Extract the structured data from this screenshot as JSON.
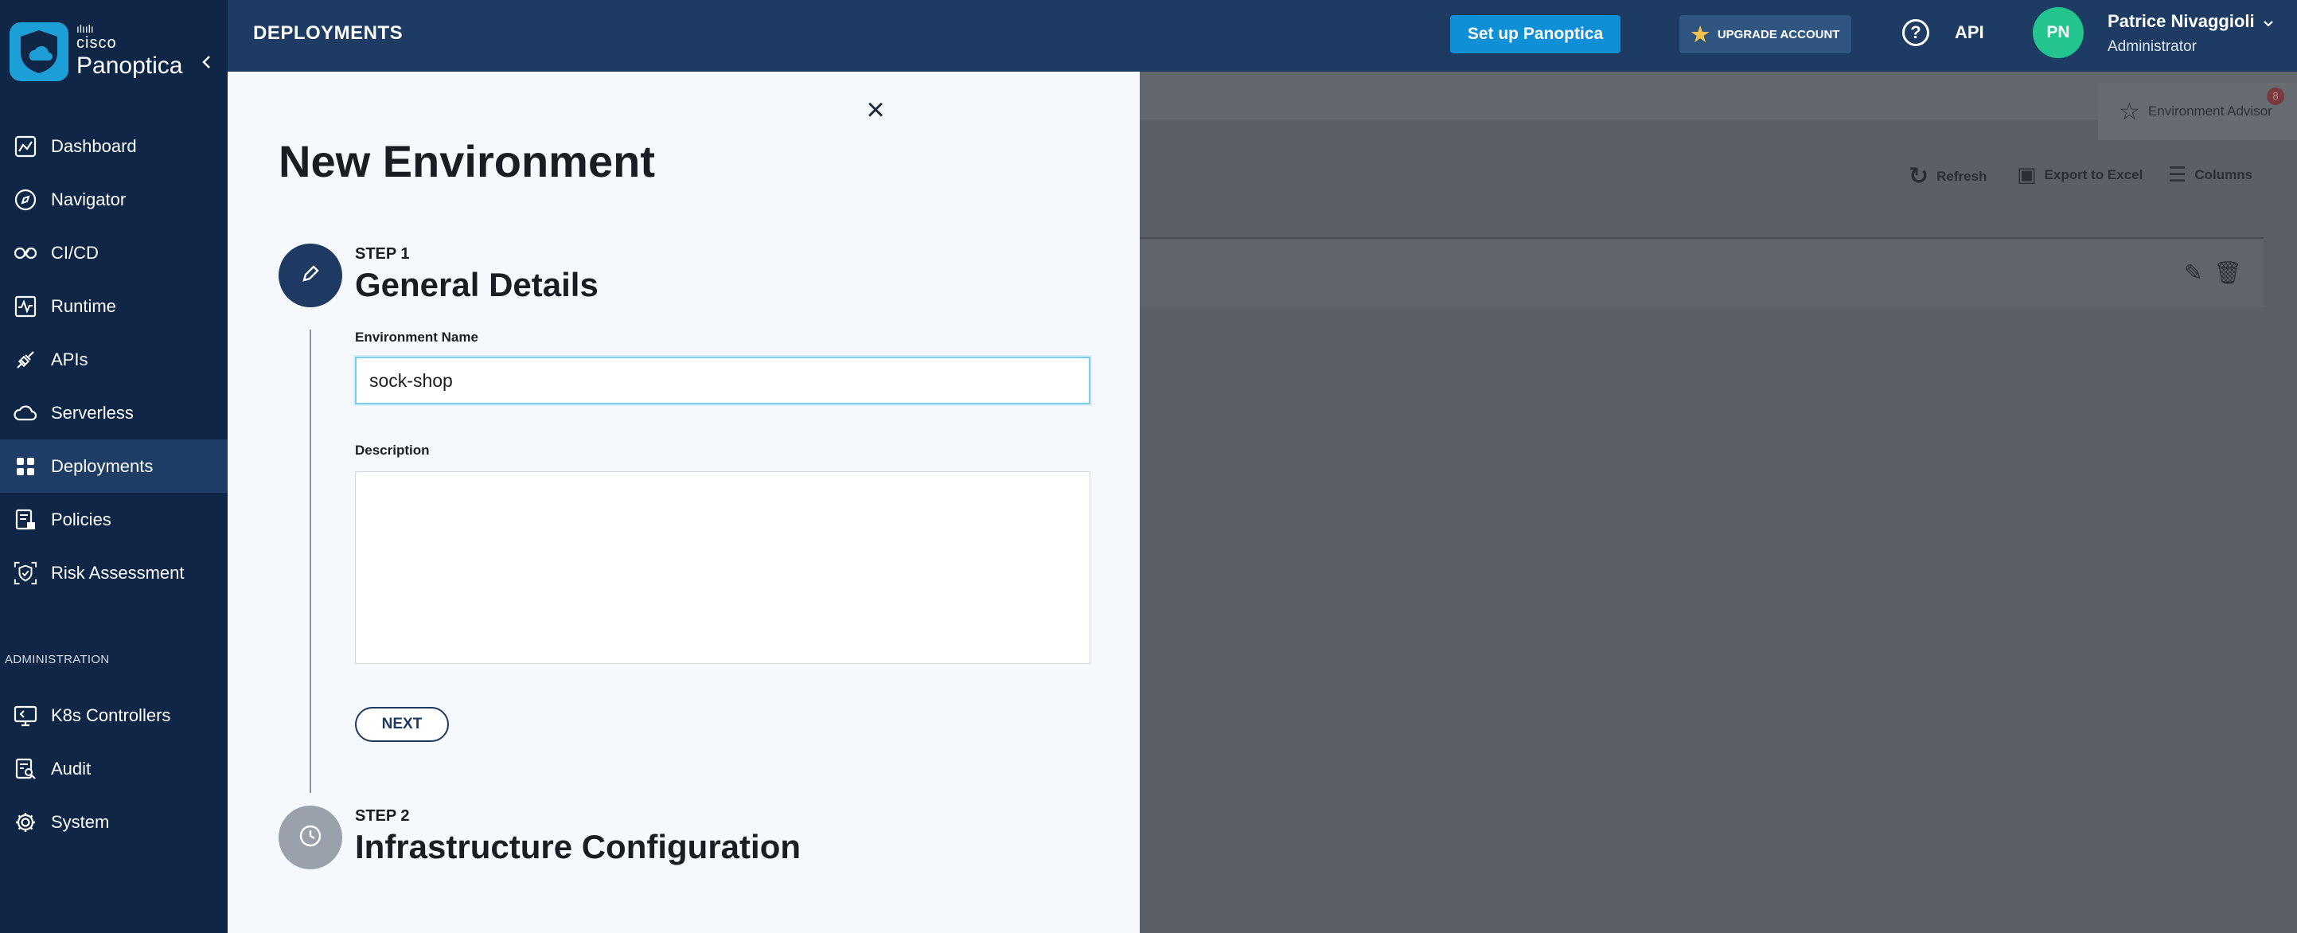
{
  "brand": {
    "company": "cisco",
    "product": "Panoptica"
  },
  "sidebar": {
    "items": [
      {
        "label": "Dashboard",
        "icon": "dashboard-icon"
      },
      {
        "label": "Navigator",
        "icon": "compass-icon"
      },
      {
        "label": "CI/CD",
        "icon": "cicd-icon"
      },
      {
        "label": "Runtime",
        "icon": "runtime-icon"
      },
      {
        "label": "APIs",
        "icon": "api-plug-icon"
      },
      {
        "label": "Serverless",
        "icon": "cloud-icon"
      },
      {
        "label": "Deployments",
        "icon": "grid-icon",
        "active": true
      },
      {
        "label": "Policies",
        "icon": "policy-lock-icon"
      },
      {
        "label": "Risk Assessment",
        "icon": "shield-scan-icon"
      }
    ],
    "admin_heading": "ADMINISTRATION",
    "admin_items": [
      {
        "label": "K8s Controllers",
        "icon": "monitor-icon"
      },
      {
        "label": "Audit",
        "icon": "audit-search-icon"
      },
      {
        "label": "System",
        "icon": "gear-icon"
      }
    ]
  },
  "topbar": {
    "title": "DEPLOYMENTS",
    "setup_label": "Set up Panoptica",
    "upgrade_label": "UPGRADE ACCOUNT",
    "help": "?",
    "api_label": "API",
    "avatar_initials": "PN",
    "user_name": "Patrice Nivaggioli",
    "user_role": "Administrator"
  },
  "background": {
    "advisor_label": "Environment Advisor",
    "advisor_badge": "8",
    "refresh_label": "Refresh",
    "export_label": "Export to Excel",
    "columns_label": "Columns"
  },
  "panel": {
    "title": "New Environment",
    "step1_label": "STEP 1",
    "step1_title": "General Details",
    "env_name_label": "Environment Name",
    "env_name_value": "sock-shop",
    "description_label": "Description",
    "description_value": "",
    "next_label": "NEXT",
    "step2_label": "STEP 2",
    "step2_title": "Infrastructure Configuration"
  },
  "colors": {
    "sidebar_bg": "#0f2647",
    "topbar_bg": "#1d3b63",
    "accent_blue": "#0f8fd6",
    "avatar_green": "#23c48e",
    "step_active": "#1e3a62",
    "step_inactive": "#9aa1ab"
  }
}
